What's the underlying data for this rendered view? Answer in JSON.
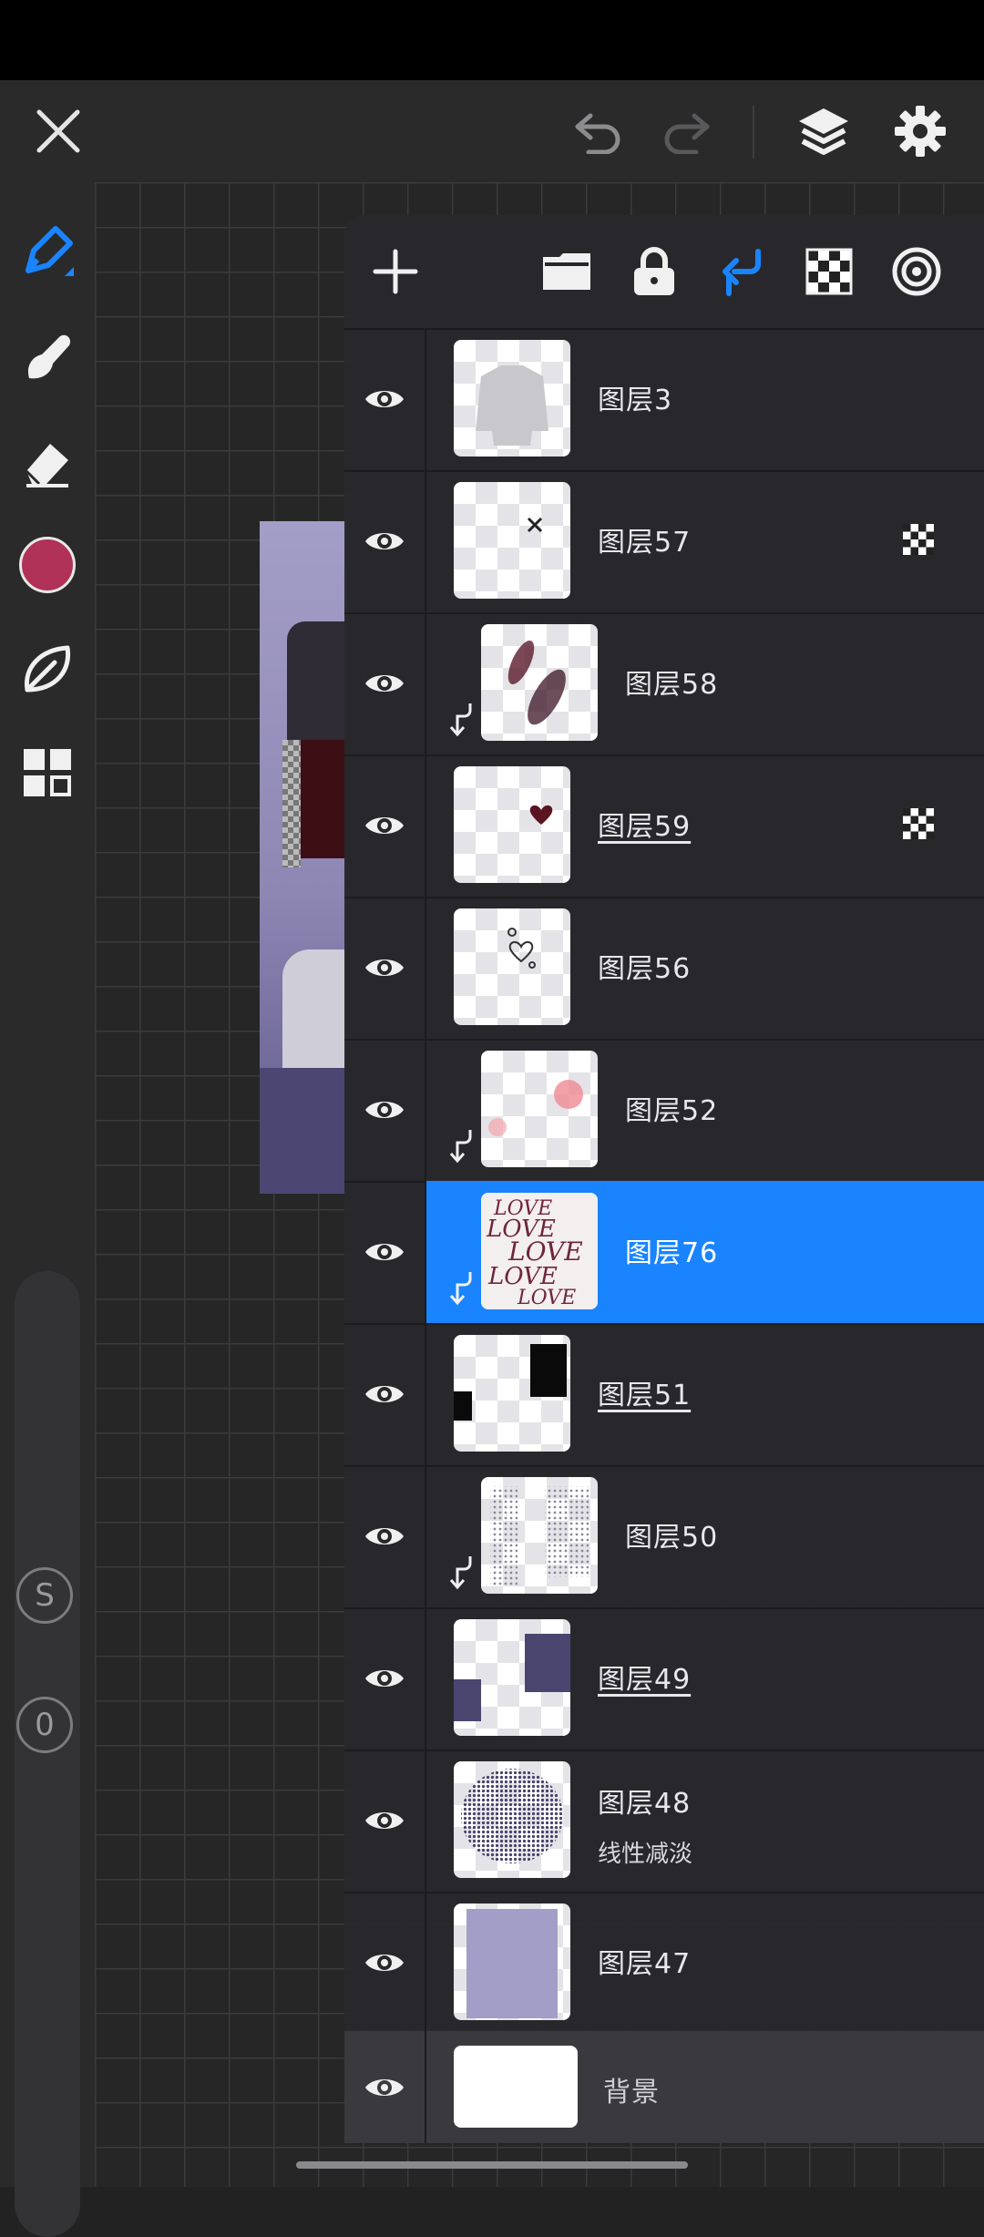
{
  "toolbar": {
    "close_icon": "close-icon",
    "undo_icon": "undo-icon",
    "redo_icon": "redo-icon",
    "layers_icon": "layers-icon",
    "settings_icon": "gear-icon"
  },
  "sidebar": {
    "tools": [
      "brush-tool",
      "smudge-tool",
      "eraser-tool",
      "color-swatch",
      "selection-tool",
      "adjustments-tool"
    ],
    "current_color": "#b03256",
    "s_label": "S",
    "zero_label": "0"
  },
  "layers_panel": {
    "actions": [
      "add-layer",
      "group-folder",
      "lock",
      "clipping-mask",
      "alpha-lock",
      "blend-target"
    ],
    "accent": "#1a84ff",
    "layers": [
      {
        "name": "图层3",
        "underline": false,
        "clip": false,
        "alpha_lock": false,
        "selected": false
      },
      {
        "name": "图层57",
        "underline": false,
        "clip": false,
        "alpha_lock": true,
        "selected": false
      },
      {
        "name": "图层58",
        "underline": false,
        "clip": true,
        "alpha_lock": false,
        "selected": false
      },
      {
        "name": "图层59",
        "underline": true,
        "clip": false,
        "alpha_lock": true,
        "selected": false
      },
      {
        "name": "图层56",
        "underline": false,
        "clip": false,
        "alpha_lock": false,
        "selected": false
      },
      {
        "name": "图层52",
        "underline": false,
        "clip": true,
        "alpha_lock": false,
        "selected": false
      },
      {
        "name": "图层76",
        "underline": false,
        "clip": true,
        "alpha_lock": false,
        "selected": true
      },
      {
        "name": "图层51",
        "underline": true,
        "clip": false,
        "alpha_lock": false,
        "selected": false
      },
      {
        "name": "图层50",
        "underline": false,
        "clip": true,
        "alpha_lock": false,
        "selected": false
      },
      {
        "name": "图层49",
        "underline": true,
        "clip": false,
        "alpha_lock": false,
        "selected": false
      },
      {
        "name": "图层48",
        "sublabel": "线性减淡",
        "underline": false,
        "clip": false,
        "alpha_lock": false,
        "selected": false
      },
      {
        "name": "图层47",
        "underline": false,
        "clip": false,
        "alpha_lock": false,
        "selected": false
      }
    ],
    "background": {
      "name": "背景"
    }
  }
}
